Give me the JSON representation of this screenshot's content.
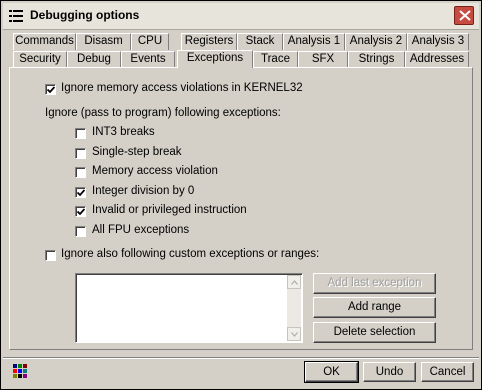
{
  "window": {
    "title": "Debugging options",
    "app_icon": "list-icon",
    "close_icon": "close-icon"
  },
  "tabs": {
    "back_row": [
      "Commands",
      "Disasm",
      "CPU",
      "Registers",
      "Stack",
      "Analysis 1",
      "Analysis 2",
      "Analysis 3"
    ],
    "front_row": [
      "Security",
      "Debug",
      "Events",
      "Exceptions",
      "Trace",
      "SFX",
      "Strings",
      "Addresses"
    ],
    "active": "Exceptions"
  },
  "panel": {
    "ignore_kernel32": {
      "label": "Ignore memory access violations in KERNEL32",
      "checked": true
    },
    "section_label": "Ignore (pass to program) following exceptions:",
    "exceptions": [
      {
        "label": "INT3 breaks",
        "checked": false
      },
      {
        "label": "Single-step break",
        "checked": false
      },
      {
        "label": "Memory access violation",
        "checked": false
      },
      {
        "label": "Integer division by 0",
        "checked": true
      },
      {
        "label": "Invalid or privileged instruction",
        "checked": true
      },
      {
        "label": "All FPU exceptions",
        "checked": false
      }
    ],
    "ignore_custom": {
      "label": "Ignore also following custom exceptions or ranges:",
      "checked": false
    },
    "custom_list_items": [],
    "buttons": {
      "add_last_exception": "Add last exception",
      "add_range": "Add range",
      "delete_selection": "Delete selection"
    }
  },
  "footer": {
    "palette_icon": "color-palette-icon",
    "ok": "OK",
    "undo": "Undo",
    "cancel": "Cancel"
  },
  "colors": {
    "dialog_face": "#d4d0c8",
    "close_button": "#c64b40",
    "titlebar": "#e7e4dc"
  }
}
